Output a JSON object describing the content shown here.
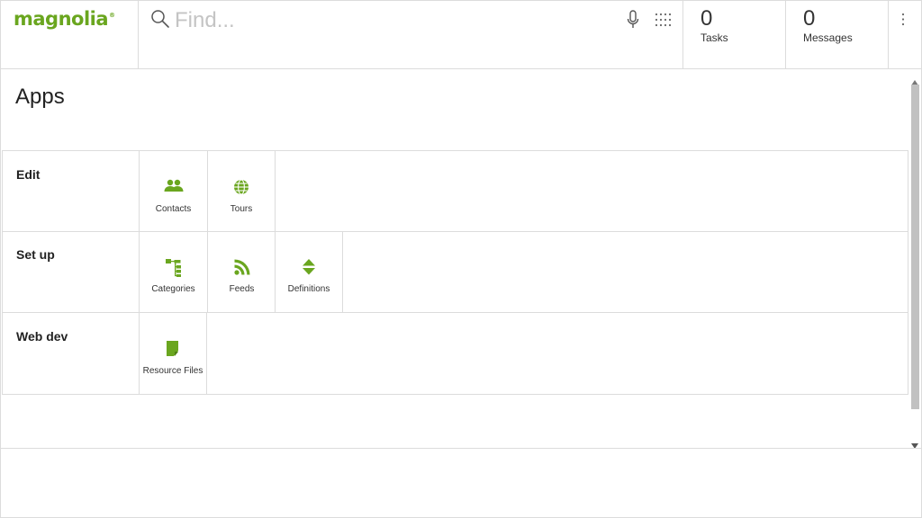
{
  "header": {
    "logo_text": "magnolia",
    "logo_mark": "®",
    "search_placeholder": "Find...",
    "tasks": {
      "count": "0",
      "label": "Tasks"
    },
    "messages": {
      "count": "0",
      "label": "Messages"
    }
  },
  "main": {
    "title": "Apps",
    "groups": [
      {
        "label": "Edit",
        "apps": [
          {
            "label": "Contacts",
            "icon": "contacts-icon"
          },
          {
            "label": "Tours",
            "icon": "globe-icon"
          }
        ]
      },
      {
        "label": "Set up",
        "apps": [
          {
            "label": "Categories",
            "icon": "tree-icon"
          },
          {
            "label": "Feeds",
            "icon": "rss-icon"
          },
          {
            "label": "Definitions",
            "icon": "definitions-icon"
          }
        ]
      },
      {
        "label": "Web dev",
        "apps": [
          {
            "label": "Resource Files",
            "icon": "file-icon"
          }
        ]
      }
    ]
  },
  "colors": {
    "accent": "#6aa61f",
    "border": "#dcdcdc",
    "scroll_thumb": "#c1c1c1"
  }
}
